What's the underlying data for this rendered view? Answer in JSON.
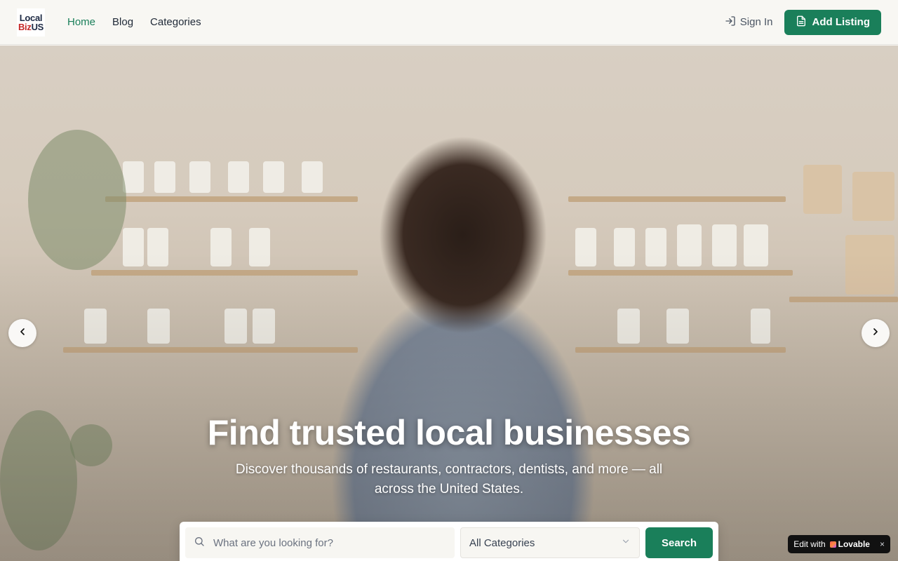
{
  "logo": {
    "line1": "Local",
    "line2_biz": "Biz",
    "line2_us": "US"
  },
  "nav": [
    {
      "label": "Home",
      "active": true
    },
    {
      "label": "Blog",
      "active": false
    },
    {
      "label": "Categories",
      "active": false
    }
  ],
  "header": {
    "signin_label": "Sign In",
    "add_listing_label": "Add Listing"
  },
  "hero": {
    "title": "Find trusted local businesses",
    "subtitle": "Discover thousands of restaurants, contractors, dentists, and more — all across the United States."
  },
  "search": {
    "placeholder": "What are you looking for?",
    "category_selected": "All Categories",
    "button_label": "Search"
  },
  "badge": {
    "prefix": "Edit with",
    "brand": "Lovable",
    "close": "×"
  },
  "colors": {
    "accent": "#1a7f5a",
    "logo_red": "#c62828",
    "logo_navy": "#1e2a44"
  }
}
